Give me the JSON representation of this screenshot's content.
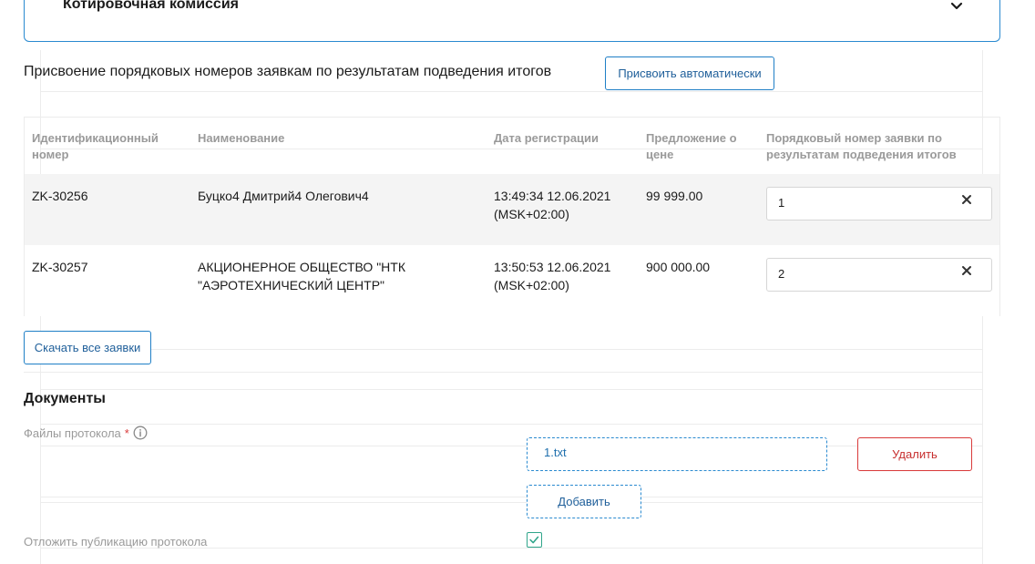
{
  "accordion": {
    "title": "Котировочная комиссия",
    "chevron_icon": "chevron-down-icon"
  },
  "numbering": {
    "heading": "Присвоение порядковых номеров заявкам по результатам подведения итогов",
    "auto_button": "Присвоить автоматически"
  },
  "table": {
    "columns": [
      "Идентификационный номер",
      "Наименование",
      "Дата регистрации",
      "Предложение о цене",
      "Порядковый номер заявки по результатам подведения итогов"
    ],
    "rows": [
      {
        "id": "ZK-30256",
        "name": "Буцко4 Дмитрий4 Олегович4",
        "date": "13:49:34 12.06.2021 (MSK+02:00)",
        "price": "99 999.00",
        "order": "1"
      },
      {
        "id": "ZK-30257",
        "name": "АКЦИОНЕРНОЕ ОБЩЕСТВО \"НТК \"АЭРОТЕХНИЧЕСКИЙ ЦЕНТР\"",
        "date": "13:50:53 12.06.2021 (MSK+02:00)",
        "price": "900 000.00",
        "order": "2"
      }
    ]
  },
  "download_button": "Скачать все заявки",
  "documents": {
    "title": "Документы",
    "files_label": "Файлы протокола",
    "required_mark": "*",
    "file_name": "1.txt",
    "delete_button": "Удалить",
    "add_button": "Добавить",
    "postpone_label": "Отложить публикацию протокола",
    "postpone_checked": true
  },
  "colors": {
    "accent": "#2a8ad0",
    "danger": "#d93a3a",
    "check": "#2fa58a"
  }
}
